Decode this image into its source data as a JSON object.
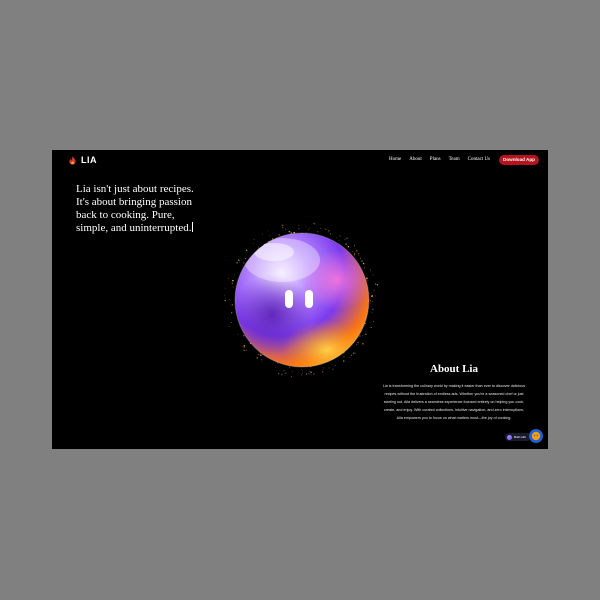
{
  "nav": {
    "logo_text": "LIA",
    "links": [
      "Home",
      "About",
      "Plans",
      "Team",
      "Contact Us"
    ],
    "download_label": "Download App"
  },
  "hero": {
    "text": "Lia isn't just about recipes. It's about bringing passion back to cooking. Pure, simple, and uninterrupted."
  },
  "about": {
    "title": "About Lia",
    "body": "Lia is transforming the culinary world by making it easier than ever to discover delicious recipes without the frustration of endless ads. Whether you're a seasoned chef or just starting out, Aila delivers a seamless experience focused entirely on helping you cook, create, and enjoy. With curated collections, intuitive navigation, and zero interruptions, Aila empowers you to focus on what matters most—the joy of cooking."
  },
  "badge": {
    "label": "Built with"
  },
  "colors": {
    "background": "#000000",
    "accent": "#b3141d",
    "outer": "#808080",
    "chat_button": "#1e5fd6"
  },
  "icons": {
    "logo": "flame-icon",
    "orb": "mascot-orb",
    "chat": "chat-icon"
  }
}
